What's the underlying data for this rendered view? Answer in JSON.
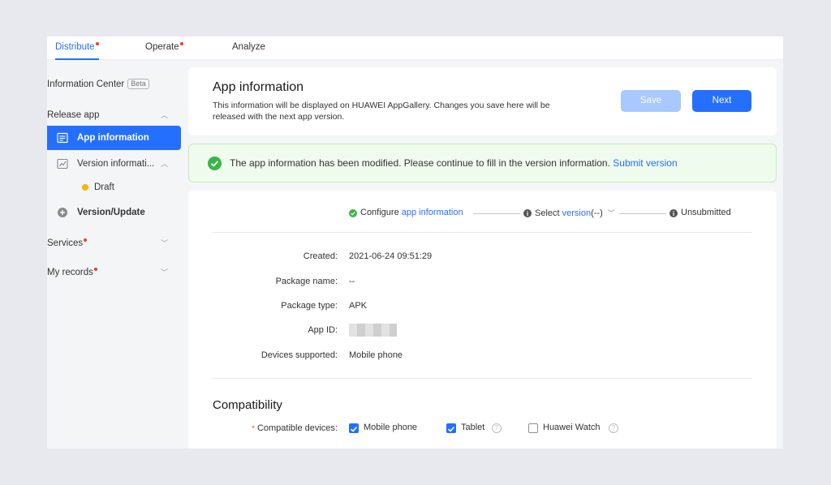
{
  "tabs": [
    {
      "label": "Distribute",
      "dot": true
    },
    {
      "label": "Operate",
      "dot": true
    },
    {
      "label": "Analyze",
      "dot": false
    }
  ],
  "sidebar": {
    "info_center": "Information Center",
    "beta": "Beta",
    "release_app": "Release app",
    "app_information": "App information",
    "version_information": "Version informati...",
    "draft": "Draft",
    "version_update": "Version/Update",
    "services": "Services",
    "my_records": "My records"
  },
  "header": {
    "title": "App information",
    "description_line1": "This information will be displayed on HUAWEI AppGallery. Changes you save here will be",
    "description_line2": "released with the next app version.",
    "save_label": "Save",
    "next_label": "Next"
  },
  "notice": {
    "message": "The app information has been modified. Please continue to fill in the version information.",
    "link": "Submit version"
  },
  "steps": {
    "step1_prefix": "Configure ",
    "step1_link": "app information",
    "step2_prefix": "Select ",
    "step2_link": "version",
    "step2_suffix": "(--)",
    "step3": "Unsubmitted"
  },
  "details": {
    "created_label": "Created:",
    "created_value": "2021-06-24 09:51:29",
    "package_name_label": "Package name:",
    "package_name_value": "--",
    "package_type_label": "Package type:",
    "package_type_value": "APK",
    "app_id_label": "App ID:",
    "devices_label": "Devices supported:",
    "devices_value": "Mobile phone"
  },
  "compatibility": {
    "title": "Compatibility",
    "required_mark": "*",
    "devices_label": "Compatible devices:",
    "options": [
      {
        "label": "Mobile phone",
        "checked": true
      },
      {
        "label": "Tablet",
        "checked": true
      },
      {
        "label": "Huawei Watch",
        "checked": false
      }
    ],
    "help_glyph": "?"
  },
  "colors": {
    "accent": "#256fff",
    "success": "#3bb54a",
    "required": "#e84026",
    "save_disabled": "#a8c8ff"
  }
}
